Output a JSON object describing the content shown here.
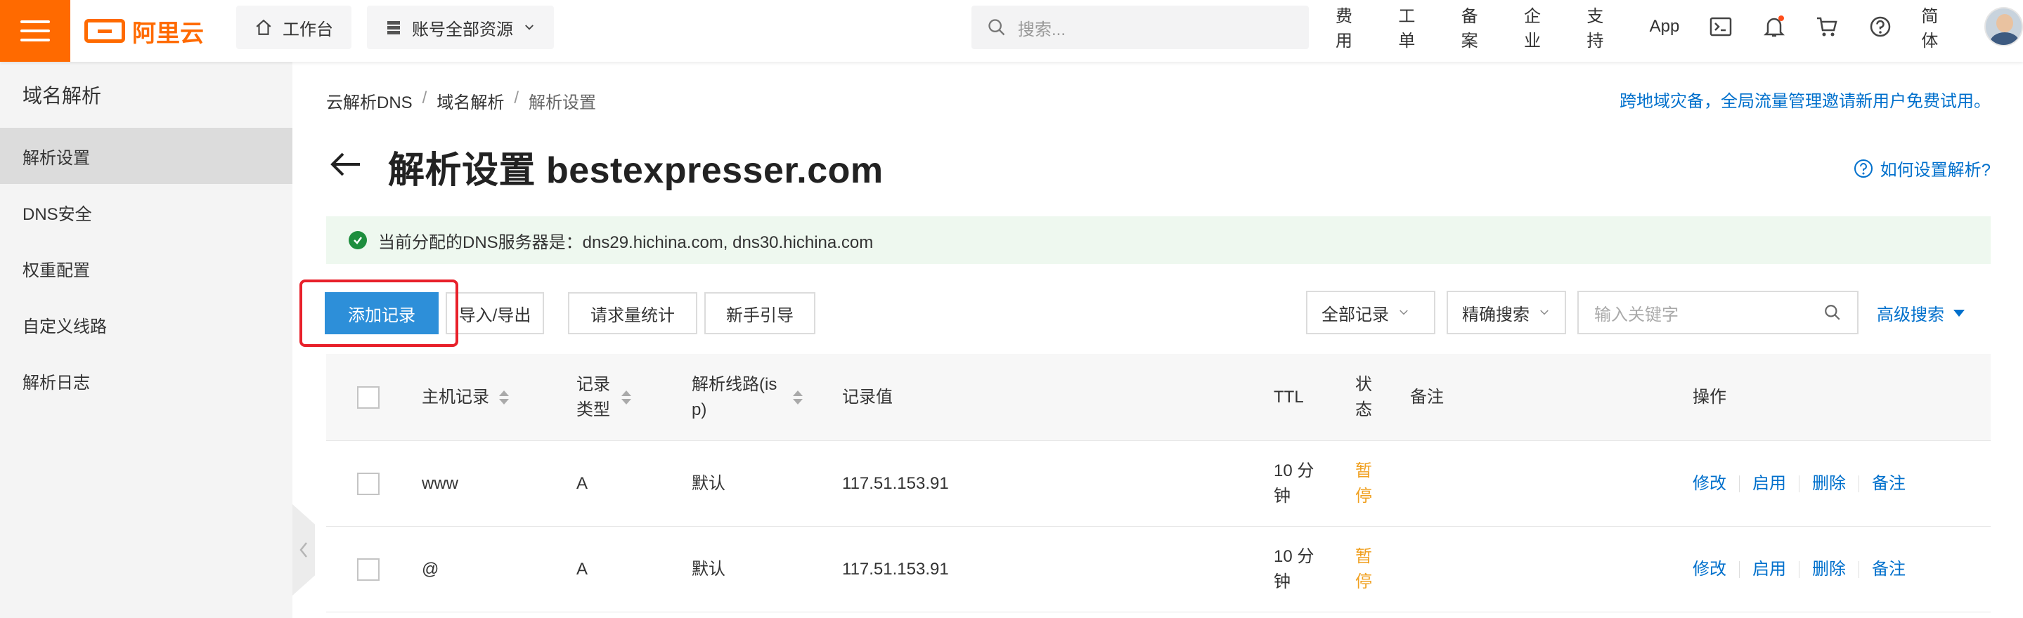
{
  "topbar": {
    "brand": "阿里云",
    "workbench": "工作台",
    "account_scope": "账号全部资源",
    "search_placeholder": "搜索...",
    "links": [
      "费用",
      "工单",
      "备案",
      "企业",
      "支持",
      "App"
    ],
    "language": "简体"
  },
  "sidebar": {
    "title": "域名解析",
    "items": [
      {
        "label": "解析设置",
        "active": true
      },
      {
        "label": "DNS安全"
      },
      {
        "label": "权重配置"
      },
      {
        "label": "自定义线路"
      },
      {
        "label": "解析日志"
      }
    ]
  },
  "breadcrumb": [
    "云解析DNS",
    "域名解析",
    "解析设置"
  ],
  "promo": "跨地域灾备，全局流量管理邀请新用户免费试用。",
  "page": {
    "title": "解析设置 bestexpresser.com",
    "help_link": "如何设置解析?"
  },
  "alert": {
    "text": "当前分配的DNS服务器是：dns29.hichina.com, dns30.hichina.com"
  },
  "toolbar": {
    "add_record": "添加记录",
    "import_export": "导入/导出",
    "request_stats": "请求量统计",
    "guide": "新手引导",
    "filter_all": "全部记录",
    "filter_mode": "精确搜索",
    "keyword_placeholder": "输入关键字",
    "advanced_search": "高级搜索"
  },
  "table": {
    "headers": {
      "host": "主机记录",
      "type": "记录类型",
      "line": "解析线路(isp)",
      "value": "记录值",
      "ttl": "TTL",
      "status": "状态",
      "remark": "备注",
      "actions": "操作"
    },
    "rows": [
      {
        "host": "www",
        "type": "A",
        "line": "默认",
        "value": "117.51.153.91",
        "ttl": "10 分钟",
        "status": "暂停",
        "remark": ""
      },
      {
        "host": "@",
        "type": "A",
        "line": "默认",
        "value": "117.51.153.91",
        "ttl": "10 分钟",
        "status": "暂停",
        "remark": ""
      }
    ],
    "row_actions": [
      "修改",
      "启用",
      "删除",
      "备注"
    ]
  },
  "colors": {
    "brand": "#ff6a00",
    "primary": "#2d8fd9",
    "link": "#0070cc",
    "paused": "#f0a020",
    "highlight": "#e8202a",
    "success_bg": "#eef8ef"
  }
}
